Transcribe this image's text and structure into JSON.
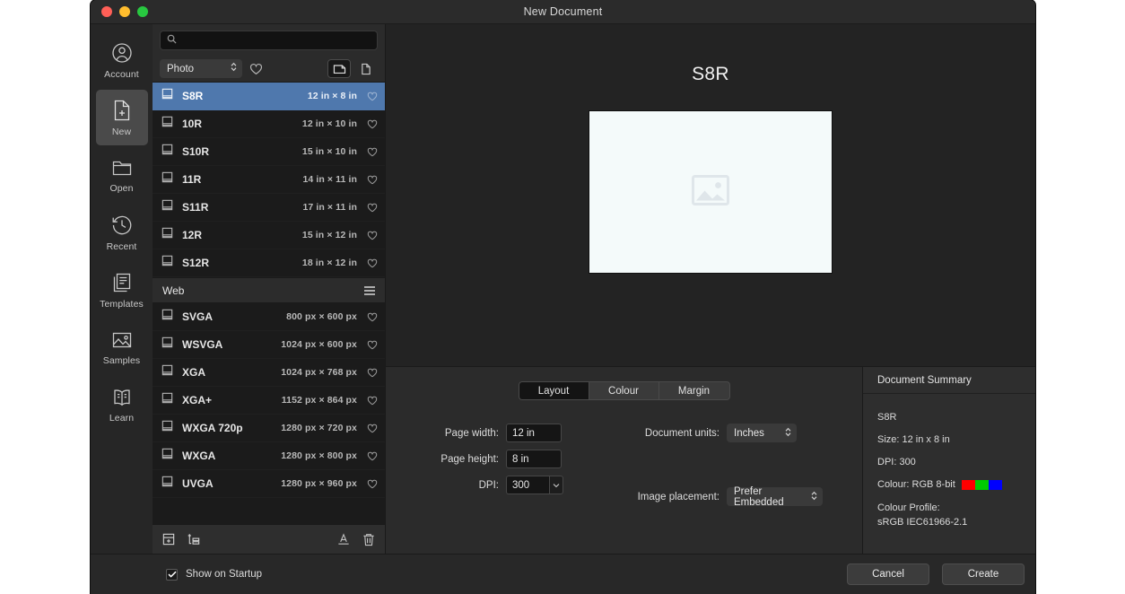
{
  "window": {
    "title": "New Document",
    "traffic_lights": [
      "close-red",
      "minimize-yellow",
      "maximize-green"
    ]
  },
  "sidebar": {
    "items": [
      {
        "id": "account",
        "label": "Account",
        "icon": "account-icon",
        "active": false
      },
      {
        "id": "new",
        "label": "New",
        "icon": "new-file-icon",
        "active": true
      },
      {
        "id": "open",
        "label": "Open",
        "icon": "folder-icon",
        "active": false
      },
      {
        "id": "recent",
        "label": "Recent",
        "icon": "clock-icon",
        "active": false
      },
      {
        "id": "templates",
        "label": "Templates",
        "icon": "templates-icon",
        "active": false
      },
      {
        "id": "samples",
        "label": "Samples",
        "icon": "image-icon",
        "active": false
      },
      {
        "id": "learn",
        "label": "Learn",
        "icon": "book-icon",
        "active": false
      }
    ]
  },
  "presets": {
    "search": {
      "value": "",
      "placeholder": ""
    },
    "filter": {
      "category_selected": "Photo",
      "favourites_icon": "heart-icon",
      "view_grid_icon": "card-view-icon",
      "view_list_icon": "page-view-icon",
      "view_selected": "card-view-icon"
    },
    "rows": [
      {
        "name": "S8R",
        "dim": "12 in × 8 in",
        "selected": true
      },
      {
        "name": "10R",
        "dim": "12 in × 10 in",
        "selected": false
      },
      {
        "name": "S10R",
        "dim": "15 in × 10 in",
        "selected": false
      },
      {
        "name": "11R",
        "dim": "14 in × 11 in",
        "selected": false
      },
      {
        "name": "S11R",
        "dim": "17 in × 11 in",
        "selected": false
      },
      {
        "name": "12R",
        "dim": "15 in × 12 in",
        "selected": false
      },
      {
        "name": "S12R",
        "dim": "18 in × 12 in",
        "selected": false
      }
    ],
    "section_header": {
      "title": "Web",
      "menu_icon": "hamburger-icon"
    },
    "rows2": [
      {
        "name": "SVGA",
        "dim": "800 px × 600 px",
        "selected": false
      },
      {
        "name": "WSVGA",
        "dim": "1024 px × 600 px",
        "selected": false
      },
      {
        "name": "XGA",
        "dim": "1024 px × 768 px",
        "selected": false
      },
      {
        "name": "XGA+",
        "dim": "1152 px × 864 px",
        "selected": false
      },
      {
        "name": "WXGA 720p",
        "dim": "1280 px × 720 px",
        "selected": false
      },
      {
        "name": "WXGA",
        "dim": "1280 px × 800 px",
        "selected": false
      },
      {
        "name": "UVGA",
        "dim": "1280 px × 960 px",
        "selected": false
      }
    ],
    "footer_icons": [
      "add-preset-icon",
      "add-category-icon",
      "rename-icon",
      "delete-icon"
    ]
  },
  "preview": {
    "title": "S8R",
    "placeholder_icon": "image-placeholder-icon",
    "canvas_color": "#f4fafa"
  },
  "settings": {
    "tabs": [
      {
        "label": "Layout",
        "active": true
      },
      {
        "label": "Colour",
        "active": false
      },
      {
        "label": "Margin",
        "active": false
      }
    ],
    "fields": {
      "page_width": {
        "label": "Page width:",
        "value": "12 in"
      },
      "page_height": {
        "label": "Page height:",
        "value": "8 in"
      },
      "dpi": {
        "label": "DPI:",
        "value": "300"
      },
      "document_units": {
        "label": "Document units:",
        "value": "Inches"
      },
      "image_placement": {
        "label": "Image placement:",
        "value": "Prefer Embedded"
      }
    }
  },
  "summary": {
    "header": "Document Summary",
    "preset_name": "S8R",
    "size": "Size: 12 in x 8 in",
    "dpi": "DPI:  300",
    "colour": "Colour: RGB 8-bit",
    "swatches": [
      "#ff0000",
      "#00cc00",
      "#0000ff"
    ],
    "profile_label": "Colour Profile:",
    "profile_value": "sRGB IEC61966-2.1"
  },
  "footer": {
    "show_on_startup": {
      "label": "Show on Startup",
      "checked": true
    },
    "cancel_label": "Cancel",
    "create_label": "Create"
  },
  "theme": {
    "accent": "#4f78ad",
    "background": "#282828"
  }
}
